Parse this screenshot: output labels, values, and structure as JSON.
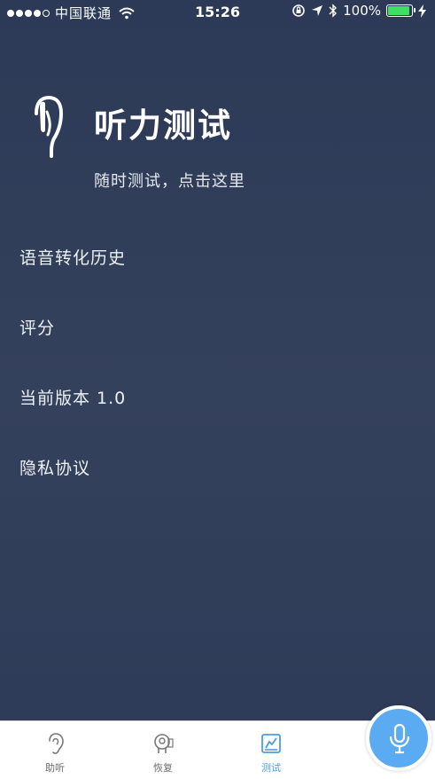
{
  "status_bar": {
    "carrier": "中国联通",
    "time": "15:26",
    "battery": "100%",
    "signal_icon": "signal-dots-icon",
    "wifi_icon": "wifi-icon",
    "rotation_icon": "rotation-lock-icon",
    "location_icon": "location-arrow-icon",
    "bluetooth_icon": "bluetooth-icon",
    "charging_icon": "charging-bolt-icon"
  },
  "header": {
    "icon": "earphone-icon",
    "title": "听力测试",
    "subtitle": "随时测试，点击这里"
  },
  "menu": {
    "items": [
      {
        "label": "语音转化历史"
      },
      {
        "label": "评分"
      },
      {
        "label": "当前版本 1.0"
      },
      {
        "label": "隐私协议"
      }
    ]
  },
  "tab_bar": {
    "tabs": [
      {
        "label": "助听",
        "icon": "ear-icon"
      },
      {
        "label": "恢复",
        "icon": "head-restore-icon"
      },
      {
        "label": "测试",
        "icon": "test-chart-icon",
        "active": true
      }
    ],
    "mic_icon": "microphone-icon"
  },
  "colors": {
    "background": "#2f3d59",
    "accent": "#5aabf2",
    "battery": "#3ee064",
    "tab_active": "#4a9de8"
  }
}
